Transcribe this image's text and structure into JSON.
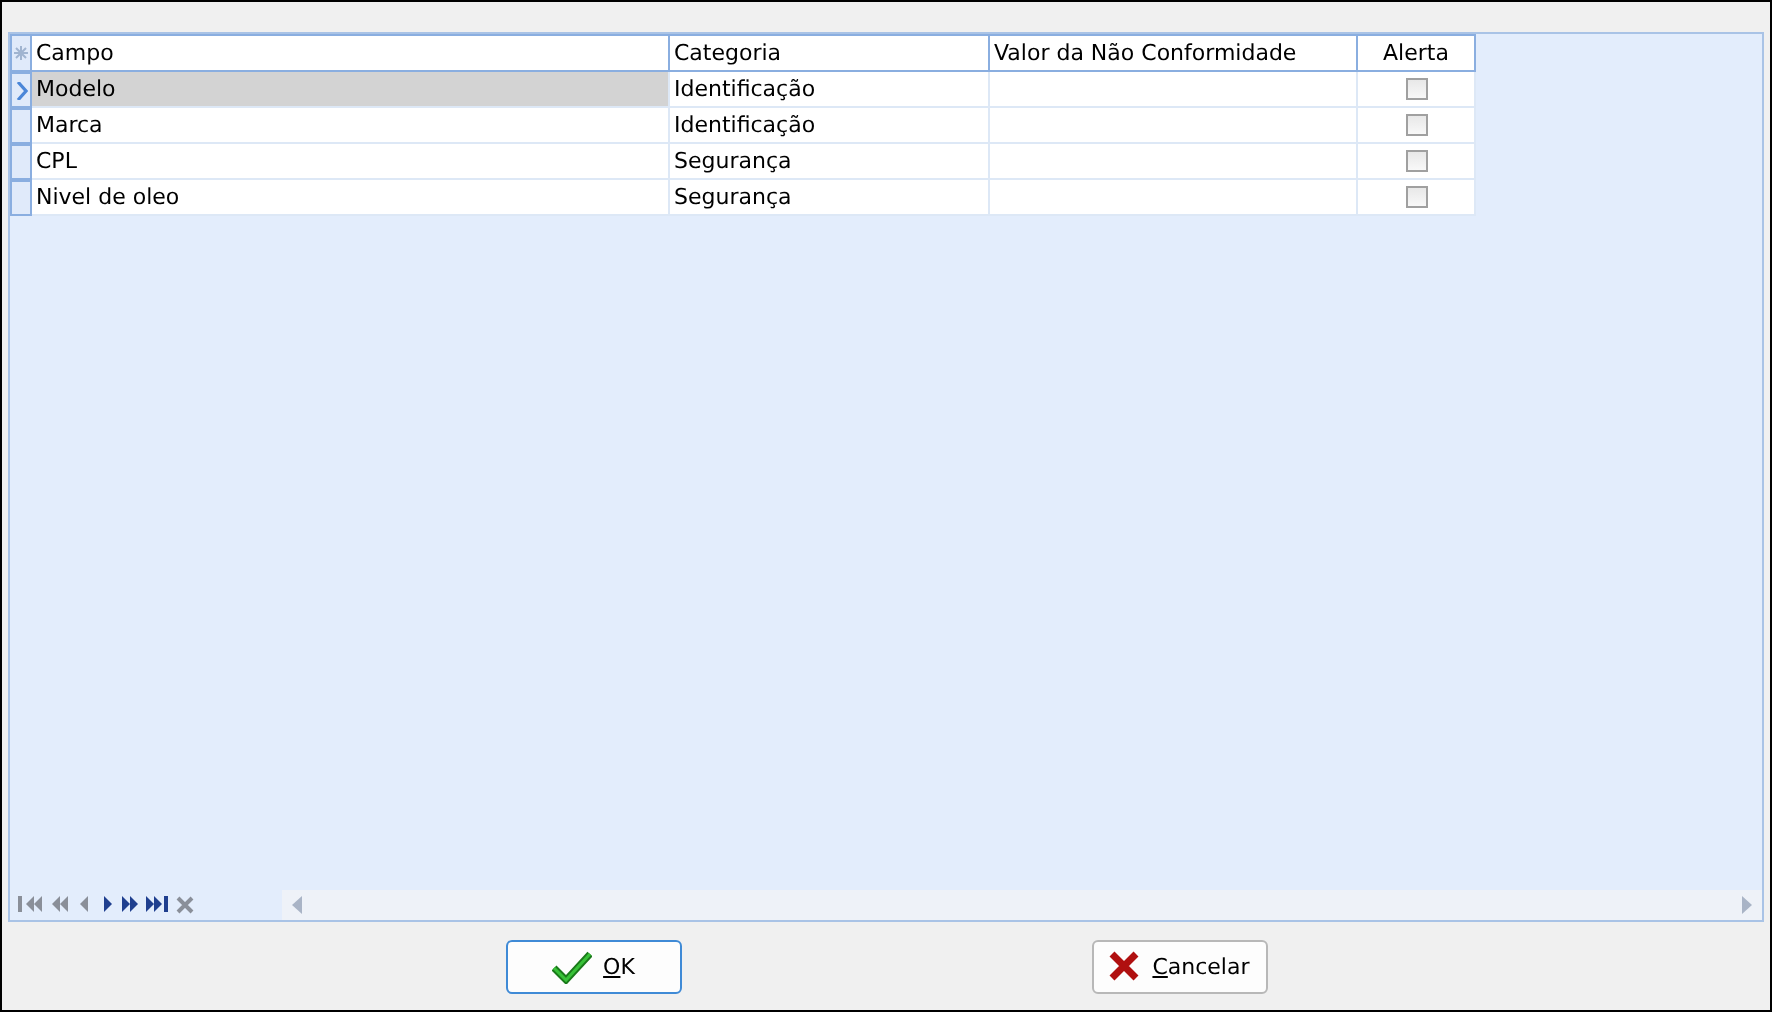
{
  "grid": {
    "columns": [
      "Campo",
      "Categoria",
      "Valor da Não Conformidade",
      "Alerta"
    ],
    "rows": [
      {
        "campo": "Modelo",
        "categoria": "Identificação",
        "valor": "",
        "alerta": false,
        "selected": true
      },
      {
        "campo": "Marca",
        "categoria": "Identificação",
        "valor": "",
        "alerta": false,
        "selected": false
      },
      {
        "campo": "CPL",
        "categoria": "Segurança",
        "valor": "",
        "alerta": false,
        "selected": false
      },
      {
        "campo": "Nivel de oleo",
        "categoria": "Segurança",
        "valor": "",
        "alerta": false,
        "selected": false
      }
    ],
    "navigator": [
      {
        "kind": "first",
        "enabled": false
      },
      {
        "kind": "prev-page",
        "enabled": false
      },
      {
        "kind": "prev",
        "enabled": false
      },
      {
        "kind": "next",
        "enabled": true
      },
      {
        "kind": "next-page",
        "enabled": true
      },
      {
        "kind": "last",
        "enabled": true
      },
      {
        "kind": "cancel",
        "enabled": false
      }
    ]
  },
  "buttons": [
    {
      "kind": "ok",
      "label": "OK",
      "focused": true
    },
    {
      "kind": "cancel",
      "label": "Cancelar",
      "focused": false
    }
  ]
}
